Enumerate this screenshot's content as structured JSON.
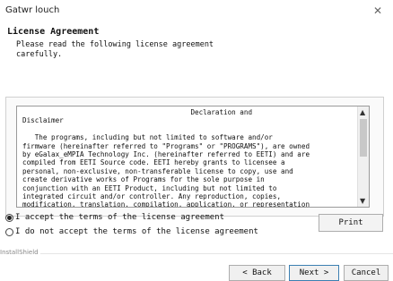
{
  "window": {
    "title": "Gatwr louch"
  },
  "header": {
    "title": "License Agreement",
    "subtitle": "Please read the following license agreement\ncarefully."
  },
  "license": {
    "text": "                                         Declaration and\nDisclaimer\n\n   The programs, including but not limited to software and/or\nfirmware (hereinafter referred to \"Programs\" or \"PROGRAMS\"), are owned\nby eGalax_eMPIA Technology Inc. (hereinafter referred to EETI) and are\ncompiled from EETI Source code. EETI hereby grants to licensee a\npersonal, non-exclusive, non-transferable license to copy, use and\ncreate derivative works of Programs for the sole purpose in\nconjunction with an EETI Product, including but not limited to\nintegrated circuit and/or controller. Any reproduction, copies,\nmodification, translation, compilation, application, or representation"
  },
  "options": {
    "accept_label": "I accept the terms of the license agreement",
    "decline_label": "I do not accept the terms of the license agreement",
    "selected": "accept"
  },
  "buttons": {
    "print": "Print",
    "back": "< Back",
    "next": "Next >",
    "cancel": "Cancel"
  },
  "footer": {
    "brand": "InstallShield"
  }
}
